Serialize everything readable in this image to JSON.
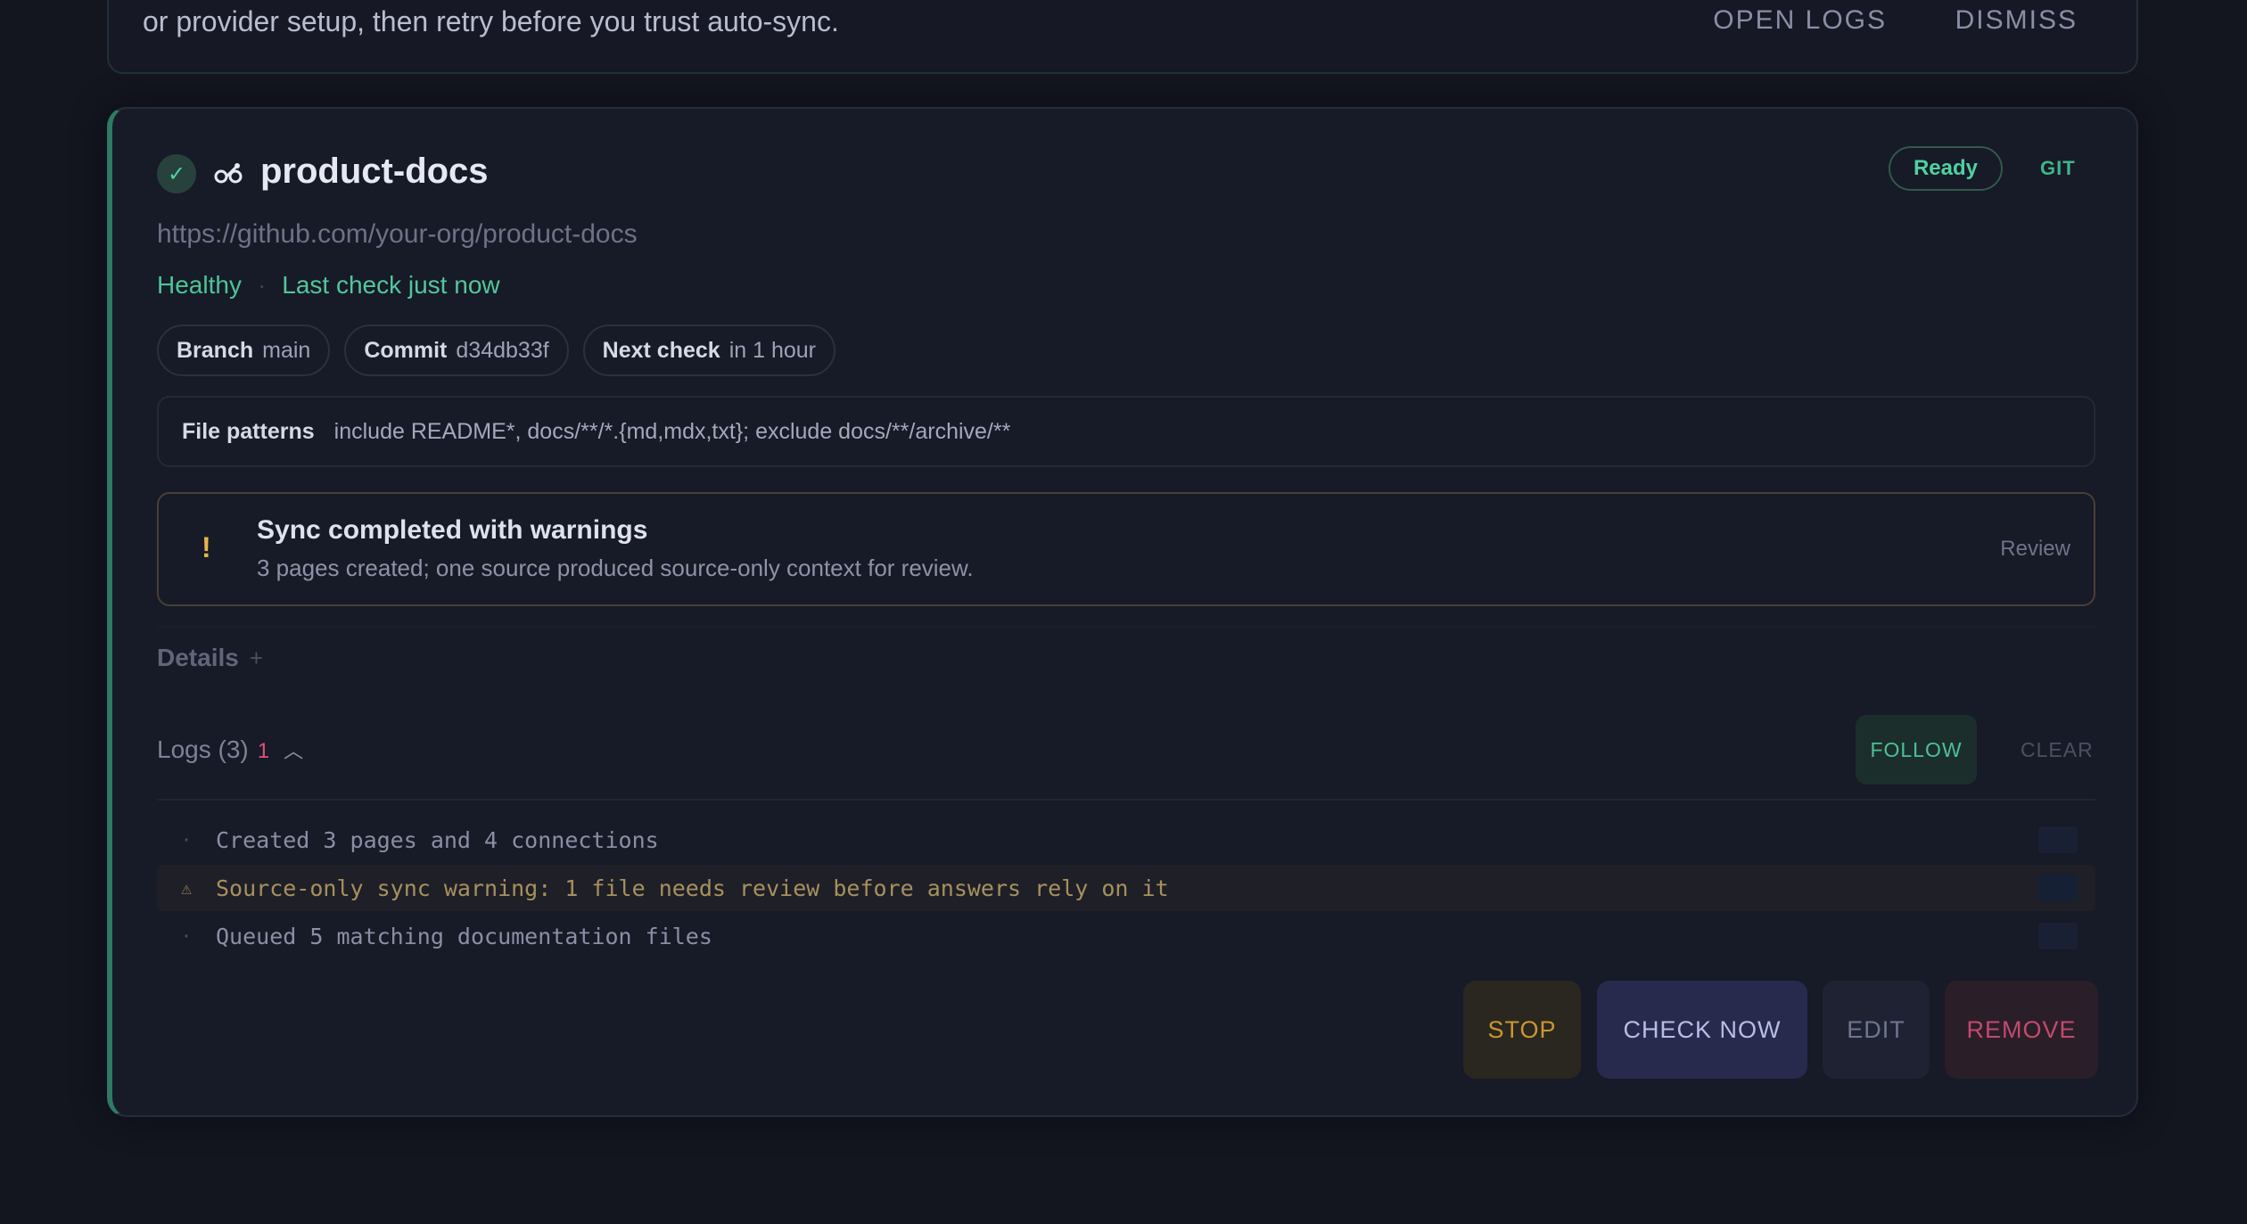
{
  "banner": {
    "text": "or provider setup, then retry before you trust auto-sync.",
    "open_logs": "OPEN LOGS",
    "dismiss": "DISMISS"
  },
  "source": {
    "status_icon": "✓",
    "type_icon": "git-icon",
    "name": "product-docs",
    "status": "Ready",
    "type_label": "GIT",
    "url": "https://github.com/your-org/product-docs",
    "health": "Healthy",
    "separator": "·",
    "last_check": "Last check just now",
    "chips": [
      {
        "label": "Branch",
        "value": "main"
      },
      {
        "label": "Commit",
        "value": "d34db33f"
      },
      {
        "label": "Next check",
        "value": "in 1 hour"
      }
    ],
    "file_patterns_label": "File patterns",
    "file_patterns_value": "include README*, docs/**/*.{md,mdx,txt}; exclude docs/**/archive/**"
  },
  "warning": {
    "icon": "!",
    "title": "Sync completed with warnings",
    "subtitle": "3 pages created; one source produced source-only context for review.",
    "review": "Review"
  },
  "details": {
    "label": "Details",
    "toggle": "+"
  },
  "logs": {
    "label": "Logs (3)",
    "warning_count": "1",
    "follow": "FOLLOW",
    "clear": "CLEAR",
    "rows": [
      {
        "mark": "·",
        "text": "Created 3 pages and 4 connections",
        "level": "info"
      },
      {
        "mark": "⚠",
        "text": "Source-only sync warning: 1 file needs review before answers rely on it",
        "level": "warn"
      },
      {
        "mark": "·",
        "text": "Queued 5 matching documentation files",
        "level": "info"
      }
    ]
  },
  "actions": {
    "stop": "STOP",
    "check_now": "CHECK NOW",
    "edit": "EDIT",
    "remove": "REMOVE"
  },
  "colors": {
    "accent_green": "#4fd1a1",
    "warning": "#e8b54a",
    "danger": "#c24a6c",
    "background": "#13151f"
  }
}
